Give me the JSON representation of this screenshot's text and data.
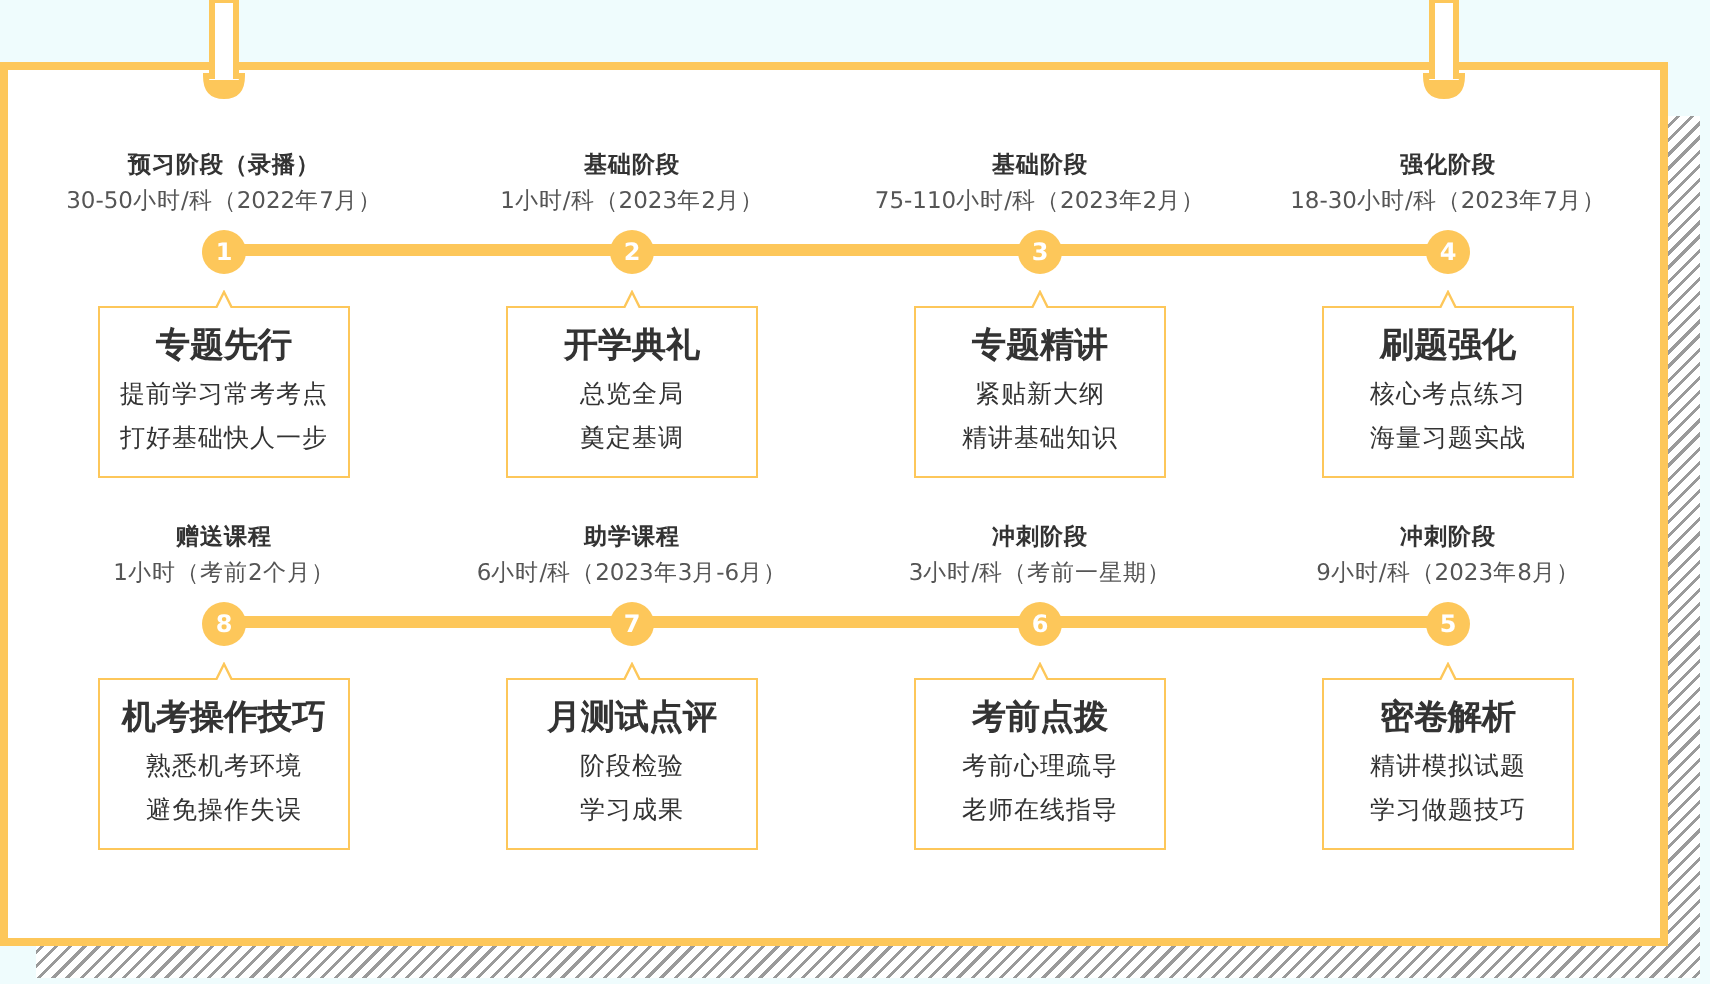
{
  "rows": [
    {
      "stages": [
        {
          "number": "1",
          "stage": "预习阶段（录播）",
          "hours": "30-50小时/科（2022年7月）",
          "heading": "专题先行",
          "lines": [
            "提前学习常考考点",
            "打好基础快人一步"
          ]
        },
        {
          "number": "2",
          "stage": "基础阶段",
          "hours": "1小时/科（2023年2月）",
          "heading": "开学典礼",
          "lines": [
            "总览全局",
            "奠定基调"
          ]
        },
        {
          "number": "3",
          "stage": "基础阶段",
          "hours": "75-110小时/科（2023年2月）",
          "heading": "专题精讲",
          "lines": [
            "紧贴新大纲",
            "精讲基础知识"
          ]
        },
        {
          "number": "4",
          "stage": "强化阶段",
          "hours": "18-30小时/科（2023年7月）",
          "heading": "刷题强化",
          "lines": [
            "核心考点练习",
            "海量习题实战"
          ]
        }
      ]
    },
    {
      "stages": [
        {
          "number": "8",
          "stage": "赠送课程",
          "hours": "1小时（考前2个月）",
          "heading": "机考操作技巧",
          "lines": [
            "熟悉机考环境",
            "避免操作失误"
          ]
        },
        {
          "number": "7",
          "stage": "助学课程",
          "hours": "6小时/科（2023年3月-6月）",
          "heading": "月测试点评",
          "lines": [
            "阶段检验",
            "学习成果"
          ]
        },
        {
          "number": "6",
          "stage": "冲刺阶段",
          "hours": "3小时/科（考前一星期）",
          "heading": "考前点拨",
          "lines": [
            "考前心理疏导",
            "老师在线指导"
          ]
        },
        {
          "number": "5",
          "stage": "冲刺阶段",
          "hours": "9小时/科（2023年8月）",
          "heading": "密卷解析",
          "lines": [
            "精讲模拟试题",
            "学习做题技巧"
          ]
        }
      ]
    }
  ]
}
